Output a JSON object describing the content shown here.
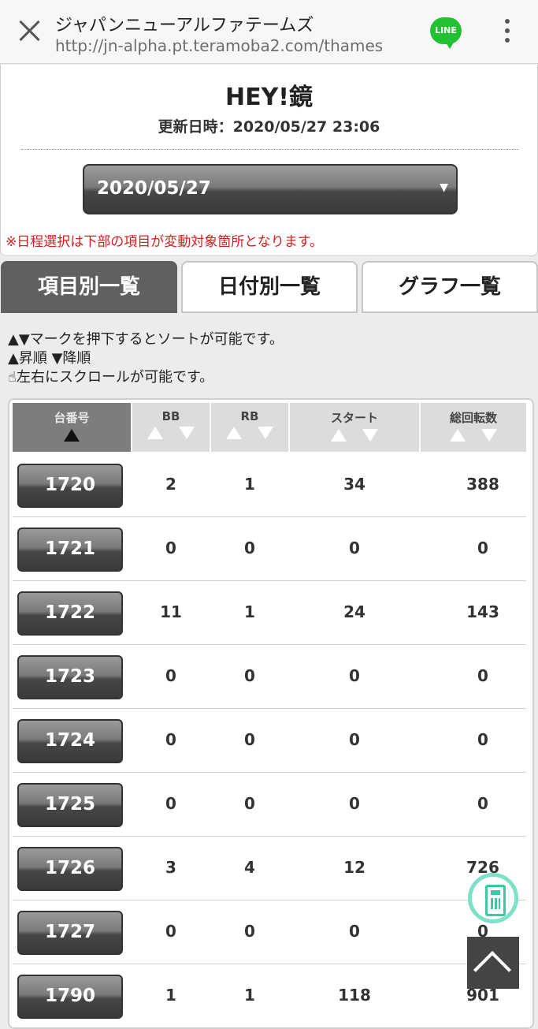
{
  "browser": {
    "title": "ジャパンニューアルファテームズ",
    "url": "http://jn-alpha.pt.teramoba2.com/thames",
    "line_label": "LINE"
  },
  "header": {
    "title": "HEY!鏡",
    "updated": "更新日時：2020/05/27 23:06",
    "date_selected": "2020/05/27",
    "note": "※日程選択は下部の項目が変動対象箇所となります。"
  },
  "tabs": [
    {
      "label": "項目別一覧",
      "active": true
    },
    {
      "label": "日付別一覧",
      "active": false
    },
    {
      "label": "グラフ一覧",
      "active": false
    }
  ],
  "instructions": [
    "▲▼マークを押下するとソートが可能です。",
    "▲昇順 ▼降順",
    "左右にスクロールが可能です。"
  ],
  "table": {
    "headers": [
      "台番号",
      "BB",
      "RB",
      "スタート",
      "総回転数"
    ],
    "rows": [
      {
        "no": "1720",
        "bb": "2",
        "rb": "1",
        "start": "34",
        "total": "388"
      },
      {
        "no": "1721",
        "bb": "0",
        "rb": "0",
        "start": "0",
        "total": "0"
      },
      {
        "no": "1722",
        "bb": "11",
        "rb": "1",
        "start": "24",
        "total": "143"
      },
      {
        "no": "1723",
        "bb": "0",
        "rb": "0",
        "start": "0",
        "total": "0"
      },
      {
        "no": "1724",
        "bb": "0",
        "rb": "0",
        "start": "0",
        "total": "0"
      },
      {
        "no": "1725",
        "bb": "0",
        "rb": "0",
        "start": "0",
        "total": "0"
      },
      {
        "no": "1726",
        "bb": "3",
        "rb": "4",
        "start": "12",
        "total": "726"
      },
      {
        "no": "1727",
        "bb": "0",
        "rb": "0",
        "start": "0",
        "total": "0"
      },
      {
        "no": "1790",
        "bb": "1",
        "rb": "1",
        "start": "118",
        "total": "901"
      }
    ]
  },
  "icons": {
    "close": "close-icon",
    "menu": "more-vert-icon",
    "calculator": "calculator-icon",
    "scroll_top": "chevron-up-icon"
  }
}
